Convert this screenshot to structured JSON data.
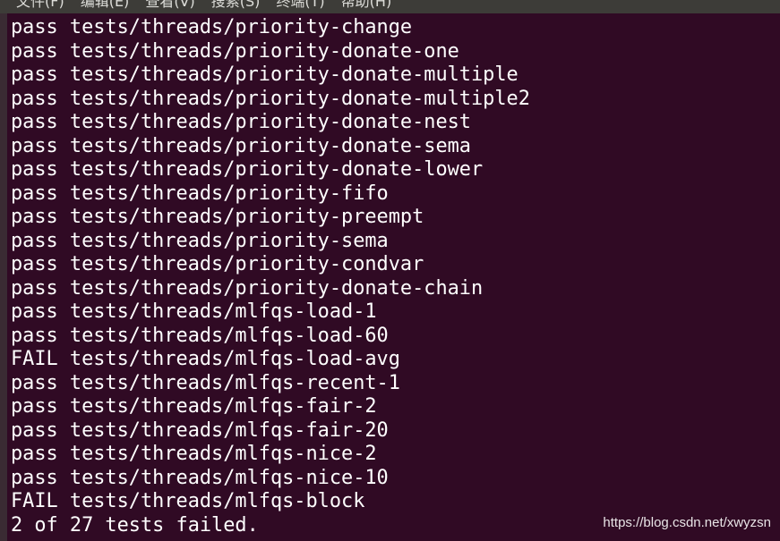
{
  "menu": [
    "文件(F)",
    "编辑(E)",
    "查看(V)",
    "搜索(S)",
    "终端(T)",
    "帮助(H)"
  ],
  "lines": [
    "pass tests/threads/priority-change",
    "pass tests/threads/priority-donate-one",
    "pass tests/threads/priority-donate-multiple",
    "pass tests/threads/priority-donate-multiple2",
    "pass tests/threads/priority-donate-nest",
    "pass tests/threads/priority-donate-sema",
    "pass tests/threads/priority-donate-lower",
    "pass tests/threads/priority-fifo",
    "pass tests/threads/priority-preempt",
    "pass tests/threads/priority-sema",
    "pass tests/threads/priority-condvar",
    "pass tests/threads/priority-donate-chain",
    "pass tests/threads/mlfqs-load-1",
    "pass tests/threads/mlfqs-load-60",
    "FAIL tests/threads/mlfqs-load-avg",
    "pass tests/threads/mlfqs-recent-1",
    "pass tests/threads/mlfqs-fair-2",
    "pass tests/threads/mlfqs-fair-20",
    "pass tests/threads/mlfqs-nice-2",
    "pass tests/threads/mlfqs-nice-10",
    "FAIL tests/threads/mlfqs-block",
    "2 of 27 tests failed."
  ],
  "watermark": "https://blog.csdn.net/xwyzsn",
  "colors": {
    "background": "#300a24",
    "text": "#ffffff",
    "menubar": "#3d3c38"
  }
}
